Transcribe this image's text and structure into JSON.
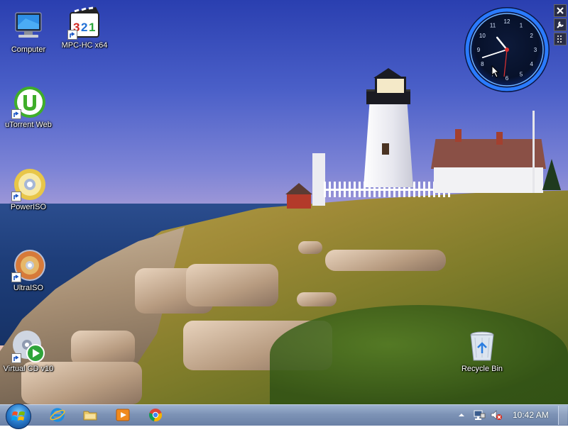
{
  "desktop": {
    "icons": [
      {
        "label": "Computer",
        "icon": "computer-icon"
      },
      {
        "label": "MPC-HC x64",
        "icon": "mpc-hc-icon"
      },
      {
        "label": "uTorrent Web",
        "icon": "utorrent-icon"
      },
      {
        "label": "PowerISO",
        "icon": "poweriso-icon"
      },
      {
        "label": "UltraISO",
        "icon": "ultraiso-icon"
      },
      {
        "label": "Virtual CD v10",
        "icon": "virtual-cd-icon"
      },
      {
        "label": "Recycle Bin",
        "icon": "recycle-bin-icon"
      }
    ]
  },
  "gadget": {
    "time": {
      "hour": 10,
      "minute": 42
    },
    "numerals": [
      "12",
      "1",
      "2",
      "3",
      "4",
      "5",
      "6",
      "7",
      "8",
      "9",
      "10",
      "11"
    ],
    "controls": [
      "close-icon",
      "wrench-icon",
      "drag-grip-icon"
    ]
  },
  "taskbar": {
    "pinned": [
      "internet-explorer-icon",
      "file-explorer-icon",
      "media-player-icon",
      "chrome-icon"
    ],
    "tray": {
      "icons": [
        "show-hidden-icons-arrow",
        "network-icon",
        "volume-muted-icon"
      ],
      "clock": "10:42 AM"
    }
  },
  "colors": {
    "taskbar": "#7d93b6",
    "clock_ring": "#1f6fff",
    "sky_top": "#2a3fb0"
  }
}
